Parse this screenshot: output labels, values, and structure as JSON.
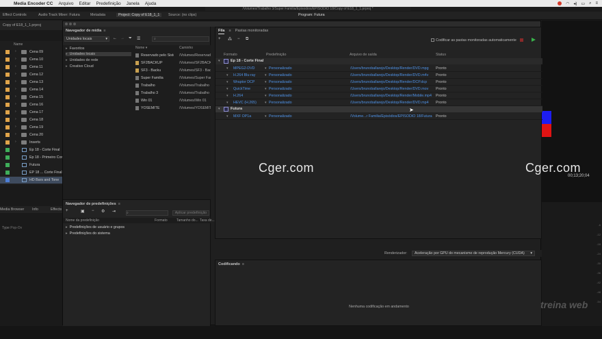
{
  "menubar": {
    "app": "Media Encoder CC",
    "items": [
      "Arquivo",
      "Editar",
      "Predefinição",
      "Janela",
      "Ajuda"
    ]
  },
  "premiere": {
    "path": "/Volumes/Trabalho 3/Super Familia/Episodios/EPISODIO 18/Copy of E18_1_1.prproj *",
    "tabs": [
      "Effect Controls",
      "Audio Track Mixer: Futura",
      "Metadata",
      "Project: Copy of E18_1_1",
      "Source: (no clips)"
    ],
    "program_tab": "Program: Futura",
    "project_file": "Copy of E18_1_1.prproj",
    "name_col": "Name",
    "project_items": [
      {
        "name": "Cena 09",
        "kind": "folder",
        "color": "#e0a44a"
      },
      {
        "name": "Cena 10",
        "kind": "folder",
        "color": "#e0a44a"
      },
      {
        "name": "Cena 11",
        "kind": "folder",
        "color": "#e0a44a"
      },
      {
        "name": "Cena 12",
        "kind": "folder",
        "color": "#e0a44a"
      },
      {
        "name": "Cena 13",
        "kind": "folder",
        "color": "#e0a44a"
      },
      {
        "name": "Cena 14",
        "kind": "folder",
        "color": "#e0a44a"
      },
      {
        "name": "Cena 15",
        "kind": "folder",
        "color": "#e0a44a"
      },
      {
        "name": "Cena 16",
        "kind": "folder",
        "color": "#e0a44a"
      },
      {
        "name": "Cena 17",
        "kind": "folder",
        "color": "#e0a44a"
      },
      {
        "name": "Cena 18",
        "kind": "folder",
        "color": "#e0a44a"
      },
      {
        "name": "Cena 19",
        "kind": "folder",
        "color": "#e0a44a"
      },
      {
        "name": "Cena 20",
        "kind": "folder",
        "color": "#e0a44a"
      },
      {
        "name": "Inserts",
        "kind": "folder",
        "color": "#e0a44a"
      },
      {
        "name": "Ep 18 - Corte Final",
        "kind": "seq",
        "color": "#3fae5a"
      },
      {
        "name": "Ep 18 - Primeiro Cor",
        "kind": "seq",
        "color": "#3fae5a"
      },
      {
        "name": "Futura",
        "kind": "seq",
        "color": "#3fae5a"
      },
      {
        "name": "EP 18 ... Corte Final",
        "kind": "seq",
        "color": "#3fae5a"
      },
      {
        "name": "HD Bars and Tone",
        "kind": "seq",
        "color": "#4d7fd8"
      }
    ],
    "bottom_tabs": [
      "Media Browser",
      "Info",
      "Effects"
    ],
    "type_label": "Type",
    "type_value": "Pop-Ov",
    "timecode": "00;13;20;04",
    "meter_ticks": [
      "-6",
      "-12",
      "-18",
      "-24",
      "-30",
      "-36",
      "-42",
      "-48",
      "-54"
    ]
  },
  "media_browser": {
    "title": "Navegador de mídia",
    "location": "Unidades locais",
    "tree": [
      "Favoritos",
      "Unidades locais",
      "Unidades de rede",
      "Creative Cloud"
    ],
    "col_name": "Nome",
    "col_path": "Caminho",
    "files": [
      {
        "name": "Reservado pelo Sistema",
        "path": "/Volumes/Reservado",
        "folder": false
      },
      {
        "name": "SF2BACKUP",
        "path": "/Volumes/SF2BACKUP",
        "folder": true
      },
      {
        "name": "SF3 - Backu",
        "path": "/Volumes/SF3 - Bac",
        "folder": true
      },
      {
        "name": "Super Familia",
        "path": "/Volumes/Super Fam",
        "folder": false
      },
      {
        "name": "Trabalho",
        "path": "/Volumes/Trabalho",
        "folder": false
      },
      {
        "name": "Trabalho 3",
        "path": "/Volumes/Trabalho",
        "folder": false
      },
      {
        "name": "Win 01",
        "path": "/Volumes/Win 01",
        "folder": false
      },
      {
        "name": "YOSEMITE",
        "path": "/Volumes/YOSEMITE",
        "folder": false
      }
    ]
  },
  "preset_browser": {
    "title": "Navegador de predefinições",
    "apply_label": "Aplicar predefinição",
    "cols": [
      "Nome da predefinição",
      "Formato",
      "Tamanho do...",
      "Taxa de..."
    ],
    "rows": [
      "Predefinições de usuário e grupos",
      "Predefinições do sistema"
    ]
  },
  "queue": {
    "tabs": [
      "Fila",
      "Pastas monitoradas"
    ],
    "auto_label": "Codificar as pastas monitoradas automaticamente",
    "cols": {
      "format": "Formato",
      "preset": "Predefinição",
      "output": "Arquivo de saída",
      "status": "Status"
    },
    "groups": [
      {
        "name": "Ep 18 - Corte Final",
        "rows": [
          {
            "format": "MPEG2-DVD",
            "preset": "Personalizado",
            "output": "/Users/brunoballarejo/Desktop/Render/DVD.mpg",
            "status": "Pronto"
          },
          {
            "format": "H.264 Blu-ray",
            "preset": "Personalizado",
            "output": "/Users/brunoballarejo/Desktop/Render/DVD.m4v",
            "status": "Pronto"
          },
          {
            "format": "Wraptor DCP",
            "preset": "Personalizado",
            "output": "/Users/brunoballarejo/Desktop/Render/DCP.dcp",
            "status": "Pronto"
          },
          {
            "format": "QuickTime",
            "preset": "Personalizado",
            "output": "/Users/brunoballarejo/Desktop/Render/DVD.mov",
            "status": "Pronto"
          },
          {
            "format": "H.264",
            "preset": "Personalizado",
            "output": "/Users/brunoballarejo/Desktop/Render/Mobile.mp4",
            "status": "Pronto"
          },
          {
            "format": "HEVC (H.265)",
            "preset": "Personalizado",
            "output": "/Users/brunoballarejo/Desktop/Render/DVD.mp4",
            "status": "Pronto"
          }
        ]
      },
      {
        "name": "Futura",
        "rows": [
          {
            "format": "MXF OP1a",
            "preset": "Personalizado",
            "output": "/Volume...r Familia/Episódios/EPISODIO 18/Futura.mxf",
            "status": "Pronto"
          }
        ]
      }
    ]
  },
  "renderer": {
    "label": "Renderizador:",
    "value": "Aceleração por GPU do mecanismo de reprodução Mercury (CUDA)"
  },
  "encoding": {
    "title": "Codificando",
    "empty": "Nenhuma codificação em andamento"
  },
  "watermark": "Cger.com",
  "brand": "treina web"
}
